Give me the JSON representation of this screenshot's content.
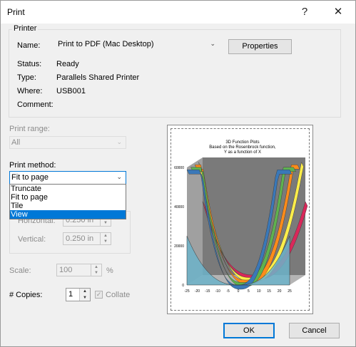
{
  "window": {
    "title": "Print",
    "help_label": "?",
    "close_label": "✕"
  },
  "printer": {
    "group_label": "Printer",
    "name_label": "Name:",
    "name_value": "Print to PDF (Mac Desktop)",
    "properties_label": "Properties",
    "status_label": "Status:",
    "status_value": "Ready",
    "type_label": "Type:",
    "type_value": "Parallels Shared Printer",
    "where_label": "Where:",
    "where_value": "USB001",
    "comment_label": "Comment:",
    "comment_value": ""
  },
  "print_range": {
    "label": "Print range:",
    "value": "All"
  },
  "print_method": {
    "label": "Print method:",
    "value": "Fit to page",
    "options": [
      "Truncate",
      "Fit to page",
      "Tile",
      "View"
    ],
    "highlighted": "View"
  },
  "margins": {
    "horizontal_label": "Horizontal:",
    "horizontal_value": "0.250 in",
    "vertical_label": "Vertical:",
    "vertical_value": "0.250 in"
  },
  "scale": {
    "label": "Scale:",
    "value": "100",
    "unit": "%"
  },
  "copies": {
    "label": "# Copies:",
    "value": "1",
    "collate_label": "Collate",
    "collate_checked": true
  },
  "buttons": {
    "ok": "OK",
    "cancel": "Cancel"
  },
  "chart_data": {
    "type": "area",
    "title": "3D Function Plots",
    "subtitle_1": "Based on the Rosenbrock function,",
    "subtitle_2": "Y as a function of X",
    "x_ticks": [
      "-25",
      "-20",
      "-15",
      "-10",
      "-5",
      "0",
      "5",
      "10",
      "15",
      "20",
      "25"
    ],
    "y_ticks": [
      "0",
      "20000",
      "40000",
      "60000"
    ],
    "xlim": [
      -25,
      25
    ],
    "ylim": [
      0,
      60000
    ],
    "ribbon_colors": [
      "#3a78b8",
      "#5fb24f",
      "#ff8c1a",
      "#ffee4a",
      "#d9285a"
    ],
    "back_area_color": "#8c8c8c",
    "front_area_color": "#6cb3c9"
  }
}
